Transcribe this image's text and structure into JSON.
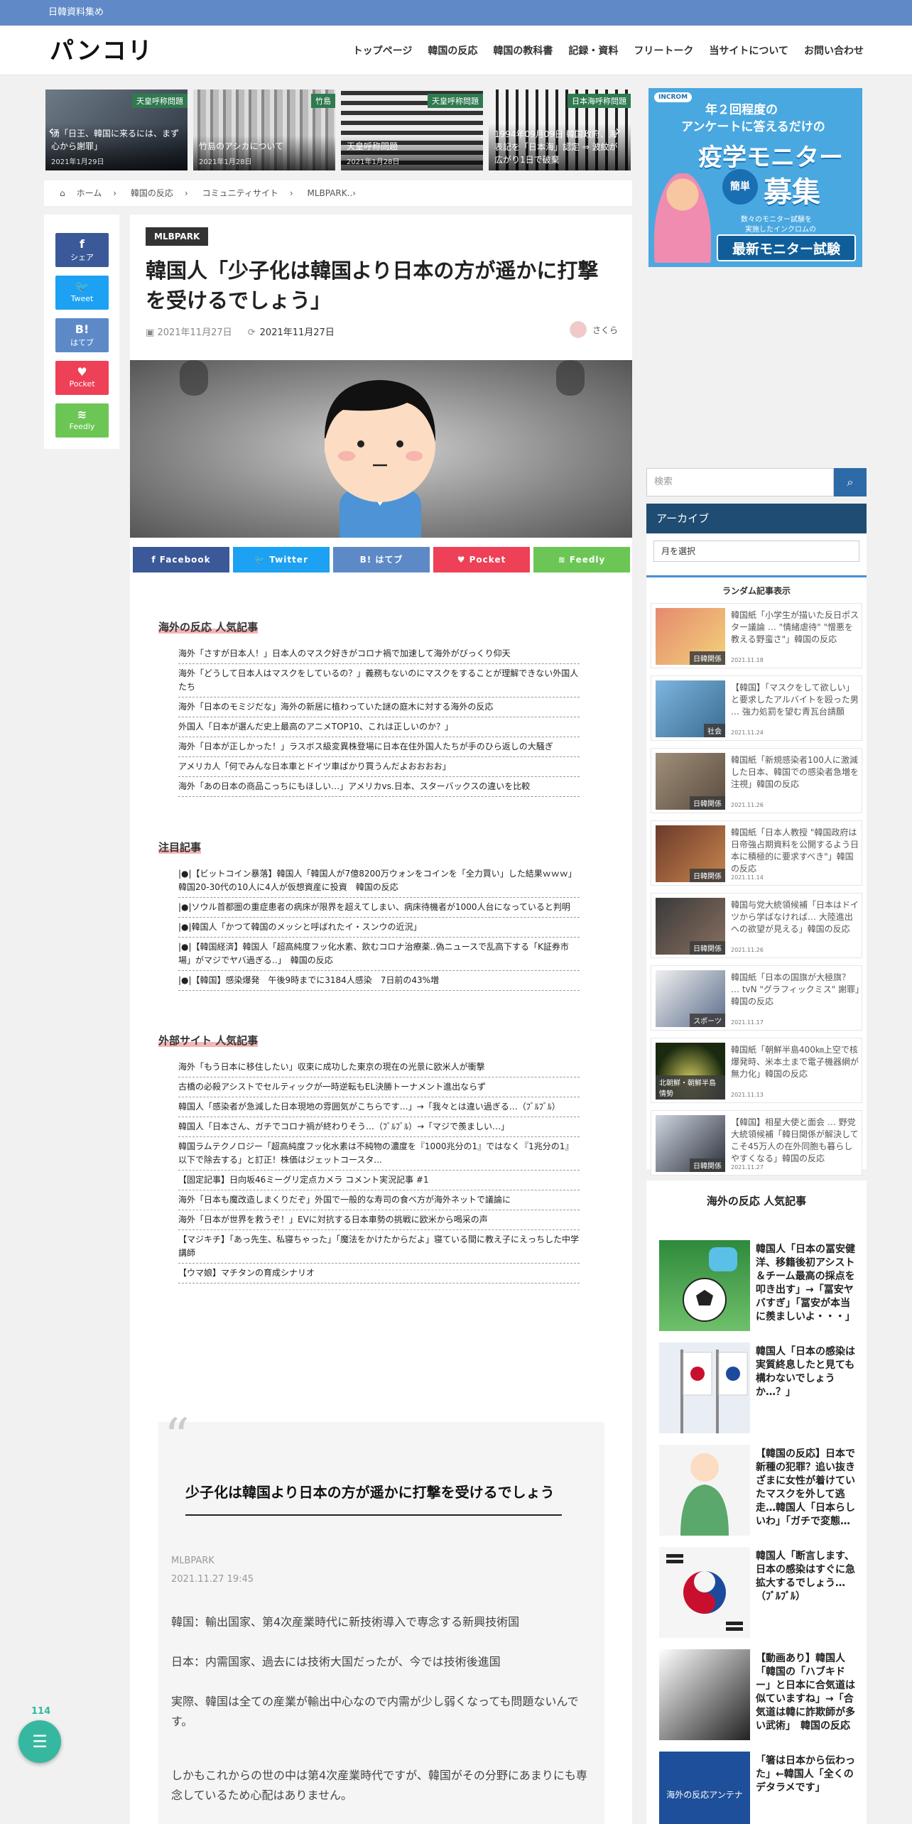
{
  "topbar": {
    "text": "日韓資料集め"
  },
  "site": {
    "logo": "パンコリ"
  },
  "nav": [
    "トップページ",
    "韓国の反応",
    "韓国の教科書",
    "記録・資料",
    "フリートーク",
    "当サイトについて",
    "お問い合わせ"
  ],
  "slides": [
    {
      "cat": "天皇呼称問題",
      "title": "湧「日王、韓国に来るには、まず心から謝罪」",
      "date": "2021年1月29日"
    },
    {
      "cat": "竹島",
      "title": "竹島のアシカについて",
      "date": "2021年1月28日"
    },
    {
      "cat": "天皇呼称問題",
      "title": "天皇呼称問題",
      "date": "2021年1月28日"
    },
    {
      "cat": "日本海呼称問題",
      "title": "1994年09月09日 韓国政府、海表記を「日本海」認定 ⇒ 波紋が広がり1日で破棄",
      "date": ""
    }
  ],
  "ad": {
    "line1": "年２回程度の",
    "line2": "アンケートに答えるだけの",
    "big1": "疫学モニター",
    "big2": "募集",
    "circle": "簡単",
    "small1": "数々のモニター試験を",
    "small2": "実施したインクロムの",
    "foot": "最新モニター試験",
    "brand": "INCROM"
  },
  "breadcrumb": [
    "ホーム",
    "韓国の反応",
    "コミュニティサイト",
    "MLBPARK..›"
  ],
  "share_side": [
    {
      "glyph": "f",
      "label": "シェア",
      "color": "#3b5998"
    },
    {
      "glyph": "🐦",
      "label": "Tweet",
      "color": "#1da1f2"
    },
    {
      "glyph": "B!",
      "label": "はてブ",
      "color": "#5d8ac7"
    },
    {
      "glyph": "♥",
      "label": "Pocket",
      "color": "#ee4056"
    },
    {
      "glyph": "≋",
      "label": "Feedly",
      "color": "#6cc655"
    }
  ],
  "article": {
    "badge": "MLBPARK",
    "title": "韓国人「少子化は韓国より日本の方が遥かに打撃を受けるでしょう」",
    "posted": "2021年11月27日",
    "updated": "2021年11月27日",
    "author": "さくら"
  },
  "share_bar": [
    {
      "label": "f  Facebook",
      "color": "#3b5998"
    },
    {
      "label": "🐦  Twitter",
      "color": "#1da1f2"
    },
    {
      "label": "B!  はてブ",
      "color": "#5d8ac7"
    },
    {
      "label": "♥  Pocket",
      "color": "#ee4056"
    },
    {
      "label": "≋  Feedly",
      "color": "#6cc655"
    }
  ],
  "sections": [
    {
      "title": "海外の反応 人気記事",
      "items": [
        "海外「さすが日本人！」日本人のマスク好きがコロナ禍で加速して海外がびっくり仰天",
        "海外「どうして日本人はマスクをしているの？」義務もないのにマスクをすることが理解できない外国人たち",
        "海外「日本のモミジだな」海外の新居に植わっていた謎の庭木に対する海外の反応",
        "外国人「日本が選んだ史上最高のアニメTOP10、これは正しいのか？」",
        "海外「日本が正しかった！」ラスボス級変異株登場に日本在住外国人たちが手のひら返しの大騒ぎ",
        "アメリカ人「何でみんな日本車とドイツ車ばかり買うんだよおおおお」",
        "海外「あの日本の商品こっちにもほしい…」アメリカvs.日本、スターバックスの違いを比較"
      ]
    },
    {
      "title": "注目記事",
      "items": [
        "|●|【ビットコイン暴落】韓国人「韓国人が7億8200万ウォンをコインを「全力買い」した結果ｗｗｗ」韓国20-30代の10人に4人が仮想資産に投資　韓国の反応",
        "|●|ソウル首都圏の重症患者の病床が限界を超えてしまい、病床待機者が1000人台になっていると判明",
        "|●|韓国人「かつて韓国のメッシと呼ばれたイ・スンウの近況」",
        "|●|【韓国経済】韓国人「超高純度フッ化水素、飲むコロナ治療薬‥偽ニュースで乱高下する「K証券市場」がマジでヤバ過ぎる‥」　韓国の反応",
        "|●|【韓国】感染爆発　午後9時までに3184人感染　7日前の43%増"
      ]
    },
    {
      "title": "外部サイト 人気記事",
      "items": [
        "海外「もう日本に移住したい」収束に成功した東京の現在の光景に欧米人が衝撃",
        "古橋の必殺アシストでセルティックが一時逆転もEL決勝トーナメント進出ならず",
        "韓国人「感染者が急減した日本現地の雰囲気がこちらです…」→「我々とは違い過ぎる…（ﾌﾞﾙﾌﾞﾙ）",
        "韓国人「日本さん、ガチでコロナ禍が終わりそう…（ﾌﾞﾙﾌﾞﾙ）→「マジで羨ましい…」",
        "韓国ラムテクノロジー「超高純度フッ化水素は不純物の濃度を『1000兆分の1』ではなく『1兆分の1』以下で除去する」と訂正！株価はジェットコースタ...",
        "【固定記事】日向坂46ミーグリ定点カメラ コメント実況記事 #1",
        "海外「日本も魔改造しまくりだぞ」外国で一般的な寿司の食べ方が海外ネットで議論に",
        "海外「日本が世界を救うぞ！」EVに対抗する日本車勢の挑戦に欧米から喝采の声",
        "【マジキチ】「あっ先生、私寝ちゃった」「魔法をかけたからだよ」寝ている間に教え子にえっちした中学講師",
        "【ウマ娘】マチタンの育成シナリオ"
      ]
    }
  ],
  "quote": {
    "title": "少子化は韓国より日本の方が遥かに打撃を受けるでしょう",
    "source": "MLBPARK",
    "datetime": "2021.11.27 19:45",
    "p1": "韓国：輸出国家、第4次産業時代に新技術導入で専念する新興技術国",
    "p2": "日本：内需国家、過去には技術大国だったが、今では技術後進国",
    "p3": "実際、韓国は全ての産業が輸出中心なので内需が少し弱くなっても問題ないんです。",
    "p4": "しかもこれからの世の中は第4次産業時代ですが、韓国がその分野にあまりにも専念しているため心配はありません。"
  },
  "sidebar": {
    "search_placeholder": "検索",
    "archive_title": "アーカイブ",
    "archive_select": "月を選択",
    "random_title": "ランダム記事表示",
    "random": [
      {
        "title": "韓国紙「小学生が描いた反日ポスター議論 … \"情緒虐待\" \"憎悪を教える野蛮さ\"」韓国の反応",
        "date": "2021.11.18",
        "cat": "日韓関係"
      },
      {
        "title": "【韓国】「マスクをして欲しい」と要求したアルバイトを殴った男 … 強力処罰を望む青瓦台請願",
        "date": "2021.11.24",
        "cat": "社会"
      },
      {
        "title": "韓国紙「新規感染者100人に激減した日本、韓国での感染者急増を注視」韓国の反応",
        "date": "2021.11.26",
        "cat": "日韓関係"
      },
      {
        "title": "韓国紙「日本人教授 \"韓国政府は日帝強占期資料を公開するよう日本に積極的に要求すべき\"」韓国の反応",
        "date": "2021.11.14",
        "cat": "日韓関係"
      },
      {
        "title": "韓国与党大統領候補「日本はドイツから学ばなければ… 大陸進出への欲望が見える」韓国の反応",
        "date": "2021.11.26",
        "cat": "日韓関係"
      },
      {
        "title": "韓国紙「日本の国旗が大極旗？ … tvN \"グラフィックミス\" 謝罪」韓国の反応",
        "date": "2021.11.17",
        "cat": "スポーツ"
      },
      {
        "title": "韓国紙「朝鮮半島400㎞上空で核爆発時、米本土まで電子機器網が無力化」韓国の反応",
        "date": "2021.11.13",
        "cat": "北朝鮮・朝鮮半島情勢"
      },
      {
        "title": "【韓国】相星大使と面会 … 野党大統領候補「韓日関係が解決してこそ45万人の在外同胞も暮らしやすくなる」韓国の反応",
        "date": "2021.11.27",
        "cat": "日韓関係"
      }
    ],
    "popular_title": "海外の反応 人気記事",
    "popular": [
      "韓国人「日本の冨安健洋、移籍後初アシスト＆チーム最高の採点を叩き出す」→「冨安ヤバすぎ」「冨安が本当に羨ましいよ・・・」",
      "韓国人「日本の感染は実質終息したと見ても構わないでしょうか…？」",
      "【韓国の反応】日本で新種の犯罪？追い抜きざまに女性が着けていたマスクを外して逃走…韓国人「日本らしいわ」「ガチで変態…",
      "韓国人「断言します、日本の感染はすぐに急拡大するでしょう…（ﾌﾞﾙﾌﾞﾙ）",
      "【動画あり】韓国人「韓国の「ハブキドー」と日本に合気道は似ていますね」→「合気道は韓に詐欺師が多い武術」　韓国の反応",
      "「箸は日本から伝わった」←韓国人「全くのデタラメです」"
    ],
    "popular_thumb6": "海外の反応アンテナ"
  },
  "fab": {
    "count": "114",
    "icon": "chat-icon"
  }
}
